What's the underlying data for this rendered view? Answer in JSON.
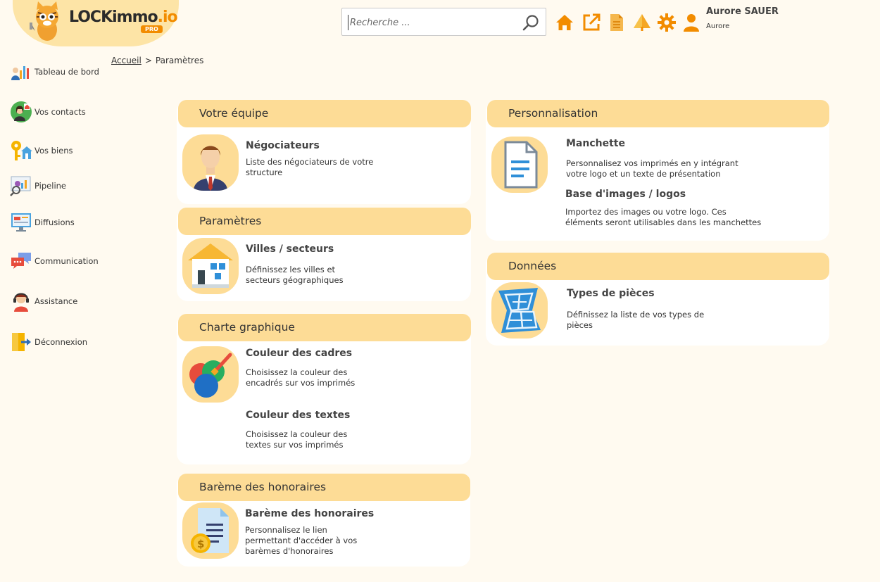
{
  "header": {
    "logo": {
      "brand_main": "LOCKimmo",
      "brand_suffix": ".io",
      "badge": "PRO"
    },
    "search": {
      "placeholder": "Recherche ..."
    },
    "icons": [
      "home-icon",
      "external-link-icon",
      "document-icon",
      "tree-icon",
      "gear-icon",
      "user-icon"
    ],
    "user": {
      "name": "Aurore SAUER",
      "subtitle": "Aurore"
    }
  },
  "breadcrumb": {
    "home": "Accueil",
    "separator": ">",
    "current": "Paramètres"
  },
  "sidebar": {
    "items": [
      {
        "label": "Tableau de bord",
        "icon": "dashboard-icon"
      },
      {
        "label": "Vos contacts",
        "icon": "contacts-icon"
      },
      {
        "label": "Vos biens",
        "icon": "key-house-icon"
      },
      {
        "label": "Pipeline",
        "icon": "pipeline-icon"
      },
      {
        "label": "Diffusions",
        "icon": "diffusion-icon"
      },
      {
        "label": "Communication",
        "icon": "chat-icon"
      },
      {
        "label": "Assistance",
        "icon": "support-icon"
      },
      {
        "label": "Déconnexion",
        "icon": "logout-icon"
      }
    ]
  },
  "sections": {
    "equipe": {
      "title": "Votre équipe",
      "entries": [
        {
          "title": "Négociateurs",
          "desc": [
            "Liste des négociateurs de votre",
            "structure"
          ],
          "icon": "agent-icon"
        }
      ]
    },
    "parametres": {
      "title": "Paramètres",
      "entries": [
        {
          "title": "Villes / secteurs",
          "desc": [
            "Définissez les villes et",
            "secteurs géographiques"
          ],
          "icon": "house-icon"
        }
      ]
    },
    "charte": {
      "title": "Charte graphique",
      "entries": [
        {
          "title": "Couleur des cadres",
          "desc": [
            "Choisissez la couleur des",
            "encadrés sur vos imprimés"
          ],
          "icon": "palette-icon"
        },
        {
          "title": "Couleur des textes",
          "desc": [
            "Choisissez la couleur des",
            "textes sur vos imprimés"
          ]
        }
      ]
    },
    "bareme": {
      "title": "Barème des honoraires",
      "entries": [
        {
          "title": "Barème des honoraires",
          "desc": [
            "Personnalisez le lien",
            "permettant d'accéder à vos",
            "barèmes d'honoraires"
          ],
          "icon": "fee-document-icon"
        }
      ]
    },
    "perso": {
      "title": "Personnalisation",
      "entries": [
        {
          "title": "Manchette",
          "desc": [
            "Personnalisez vos imprimés en y intégrant",
            "votre logo et un texte de présentation"
          ],
          "icon": "letterhead-icon"
        },
        {
          "title": "Base d'images / logos",
          "desc": [
            "Importez des images ou votre logo. Ces",
            "éléments seront utilisables dans les manchettes"
          ]
        }
      ]
    },
    "donnees": {
      "title": "Données",
      "entries": [
        {
          "title": "Types de pièces",
          "desc": [
            "Définissez la liste de vos types de",
            "pièces"
          ],
          "icon": "floorplan-icon"
        }
      ]
    }
  },
  "colors": {
    "background": "#fffaf0",
    "card_header": "#fddc96",
    "accent_orange": "#f28c00",
    "text": "#333333"
  }
}
